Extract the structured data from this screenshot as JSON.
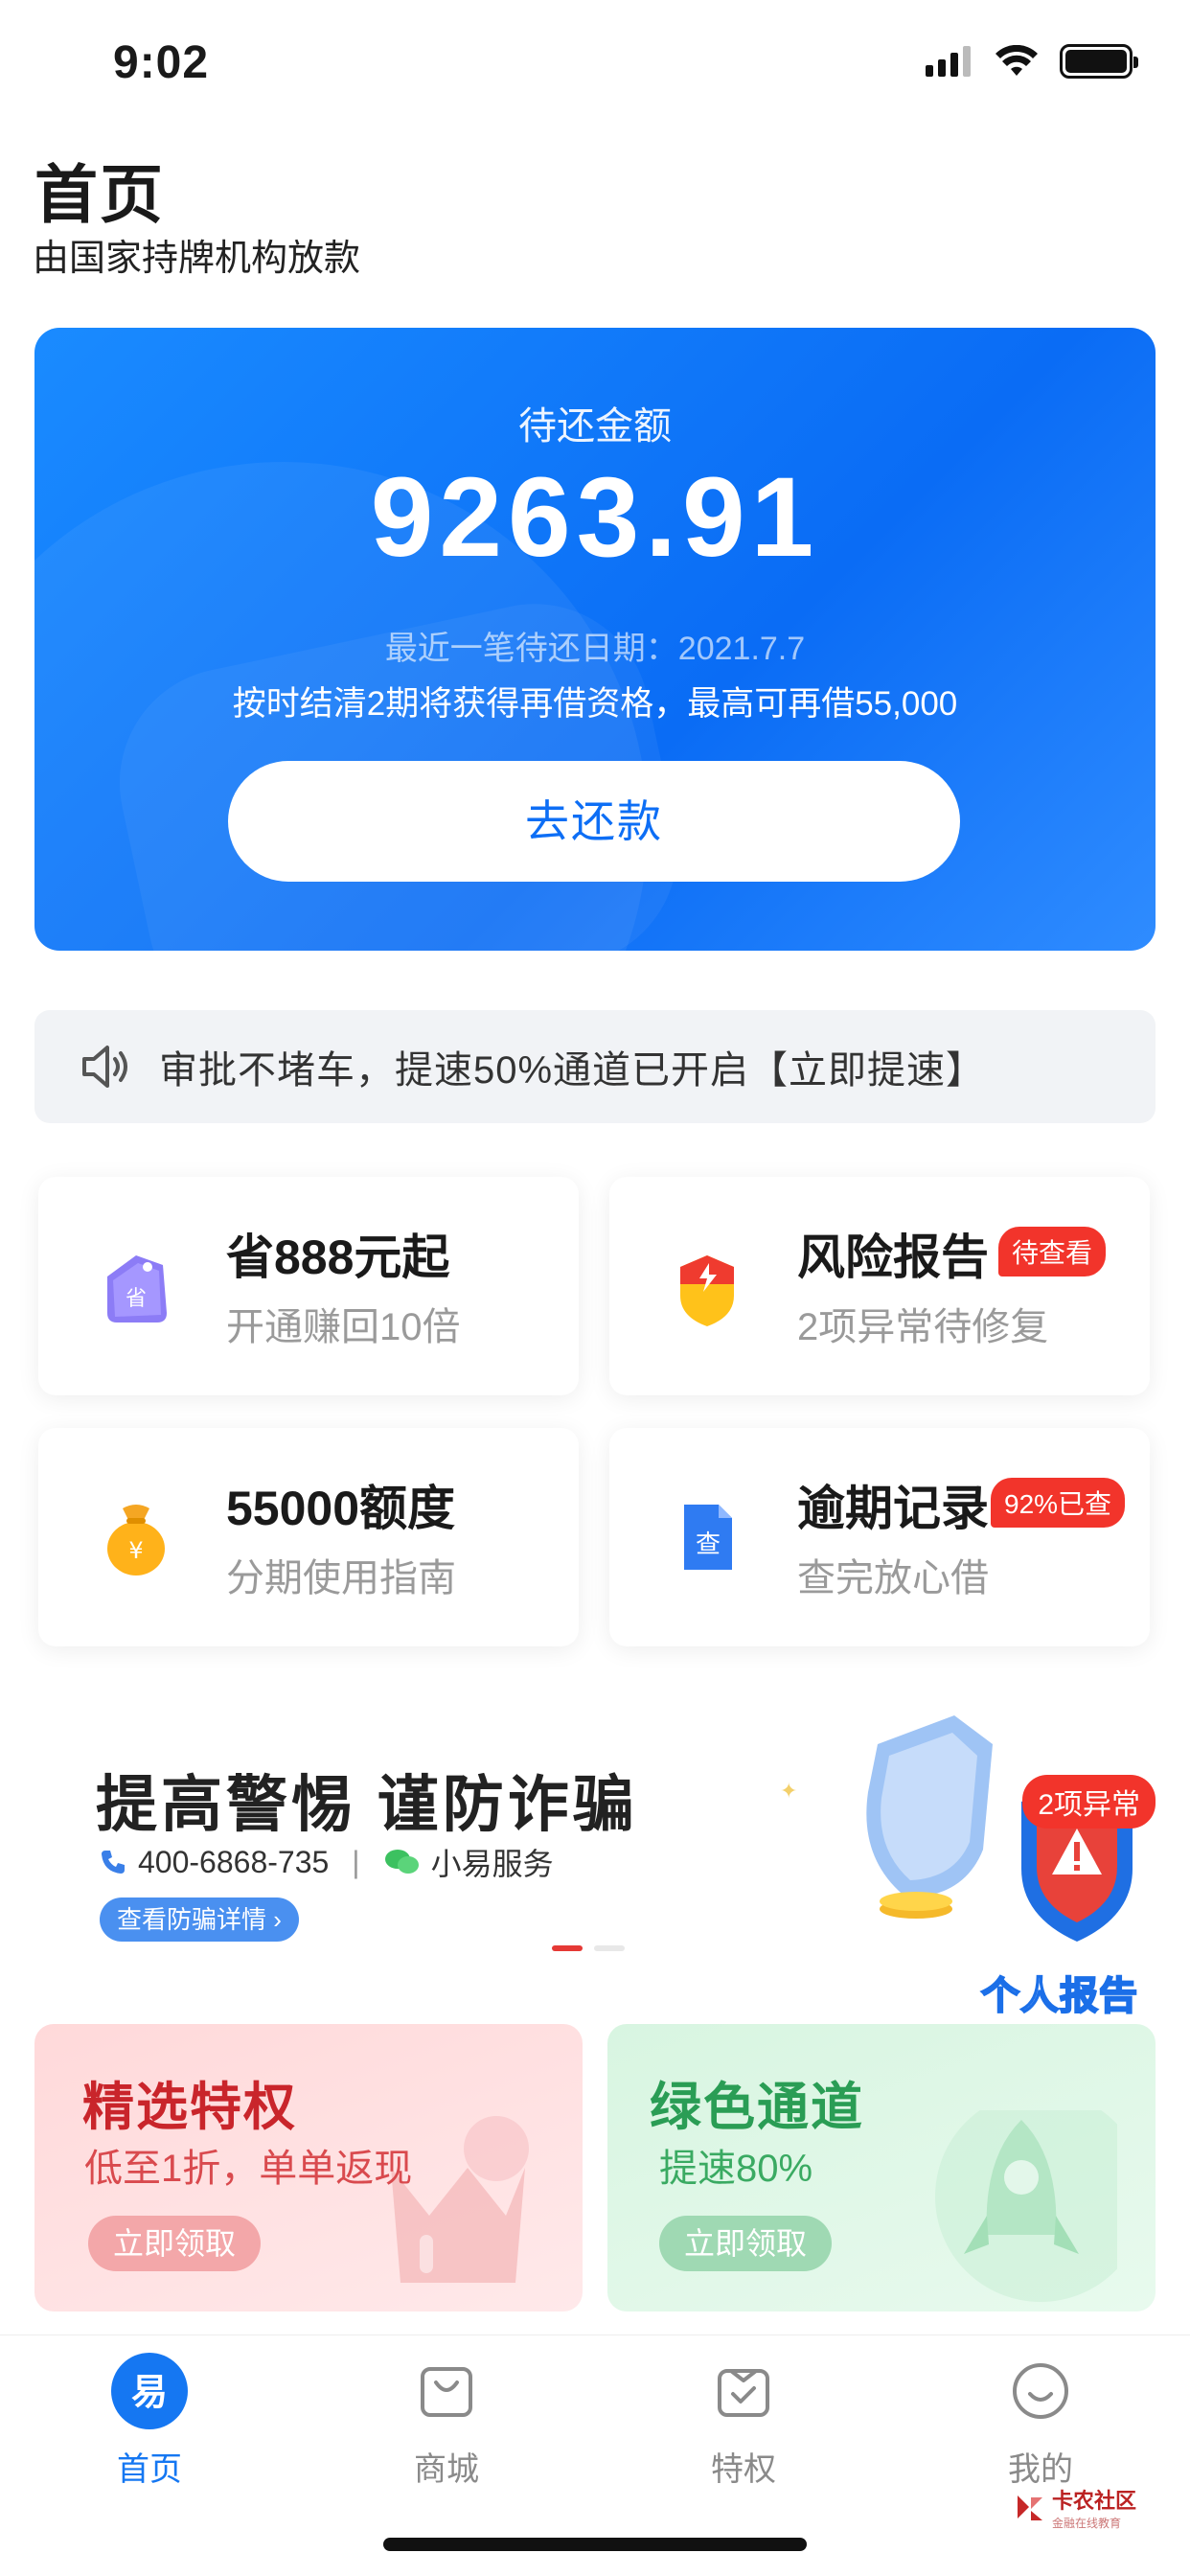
{
  "status_bar": {
    "time": "9:02"
  },
  "header": {
    "title": "首页",
    "subtitle": "由国家持牌机构放款"
  },
  "repayment": {
    "label": "待还金额",
    "amount": "9263.91",
    "next_date": "最近一笔待还日期：2021.7.7",
    "tip": "按时结清2期将获得再借资格，最高可再借55,000",
    "button": "去还款"
  },
  "notice": {
    "text": "审批不堵车，提速50%通道已开启【立即提速】"
  },
  "features": [
    {
      "title": "省888元起",
      "desc": "开通赚回10倍",
      "badge": ""
    },
    {
      "title": "风险报告",
      "desc": "2项异常待修复",
      "badge": "待查看"
    },
    {
      "title": "55000额度",
      "desc": "分期使用指南",
      "badge": ""
    },
    {
      "title": "逾期记录",
      "desc": "查完放心借",
      "badge": "92%已查"
    }
  ],
  "banner": {
    "title": "提高警惕 谨防诈骗",
    "phone": "400-6868-735",
    "wechat": "小易服务",
    "link": "查看防骗详情 ›",
    "badge": "2项异常",
    "report": "个人报告"
  },
  "promos": [
    {
      "title": "精选特权",
      "desc": "低至1折，单单返现",
      "button": "立即领取"
    },
    {
      "title": "绿色通道",
      "desc": "提速80%",
      "button": "立即领取"
    }
  ],
  "tabs": [
    {
      "label": "首页",
      "icon": "home-logo-icon",
      "active": true
    },
    {
      "label": "商城",
      "icon": "shopping-bag-icon",
      "active": false
    },
    {
      "label": "特权",
      "icon": "privilege-icon",
      "active": false
    },
    {
      "label": "我的",
      "icon": "smiley-icon",
      "active": false
    }
  ],
  "watermark": {
    "text": "卡农社区",
    "sub": "金融在线教育"
  },
  "colors": {
    "primary": "#1577f2",
    "badge_red": "#f2342b",
    "promo_red": "#c9252b",
    "promo_green": "#2a9d55"
  }
}
